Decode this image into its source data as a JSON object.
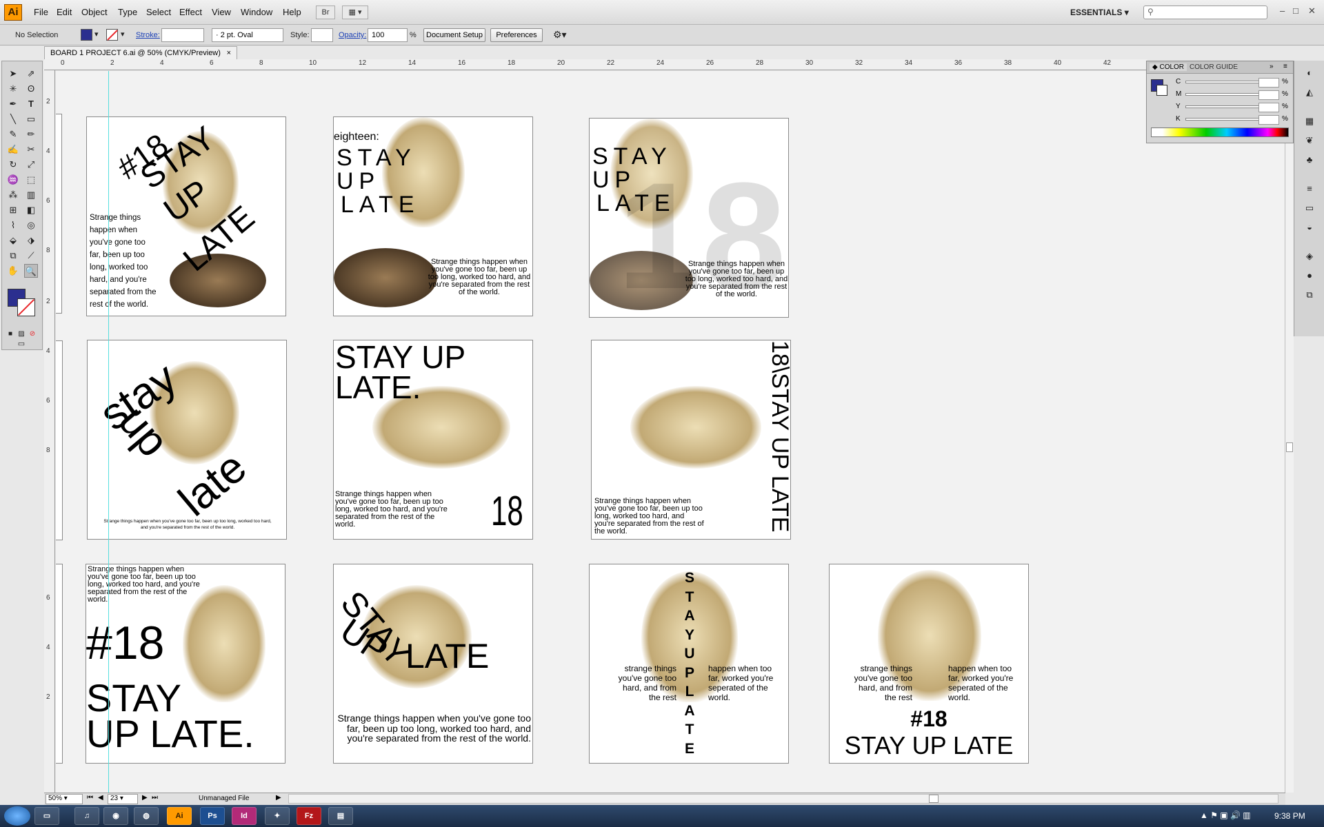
{
  "app": {
    "logo": "Ai"
  },
  "menus": [
    "File",
    "Edit",
    "Object",
    "Type",
    "Select",
    "Effect",
    "View",
    "Window",
    "Help"
  ],
  "bridge_btn": "Br",
  "workspace": "ESSENTIALS",
  "control": {
    "selection": "No Selection",
    "stroke_label": "Stroke:",
    "brush": "2 pt. Oval",
    "style_label": "Style:",
    "opacity_label": "Opacity:",
    "opacity_value": "100",
    "percent": "%",
    "document_setup": "Document Setup",
    "preferences": "Preferences"
  },
  "doc_tab": {
    "title": "BOARD 1 PROJECT 6.ai @ 50% (CMYK/Preview)",
    "close": "×"
  },
  "ruler_h": [
    "0",
    "2",
    "4",
    "6",
    "8",
    "10",
    "12",
    "14",
    "16",
    "18",
    "20",
    "22",
    "24",
    "26",
    "28",
    "30",
    "32",
    "34",
    "36",
    "38",
    "40",
    "42"
  ],
  "ruler_v": [
    "2",
    "4",
    "6",
    "8",
    "2",
    "4",
    "6",
    "8",
    "6",
    "4",
    "2"
  ],
  "artboards": {
    "a1": {
      "l1": "#18",
      "l2": "STAY",
      "l3": "UP",
      "l4": "LATE",
      "body": "Strange things happen when you've gone too far, been up too long, worked too hard, and you're separated from the rest of the world."
    },
    "a2": {
      "eighteen": "eighteen:",
      "s1": "STAY",
      "s2": "UP",
      "s3": "LATE",
      "body": "Strange things happen when you've gone too far, been up too long, worked too hard, and you're separated from the rest of the world."
    },
    "a3": {
      "s1": "STAY",
      "s2": "UP",
      "s3": "LATE",
      "big18": "18",
      "body": "Strange things happen when you've gone too far, been up too long, worked too hard, and you're separated from the rest of the world."
    },
    "a4": {
      "w1": "stay",
      "w2": "up",
      "w3": "late",
      "small": "Strange things happen when you've gone too far, been up too long, worked too hard, and you're separated from the rest of the world."
    },
    "a5": {
      "head": "STAY UP LATE.",
      "body": "Strange things happen when you've gone too far, been up too long, worked too hard, and you're separated from the rest of the world.",
      "num": "18"
    },
    "a6": {
      "vert": "18\\STAY UP LATE",
      "body": "Strange things happen when you've gone too far, been up too long, worked too hard, and you're separated from the rest of the world."
    },
    "a7": {
      "body": "Strange things happen when you've gone too far, been up too long, worked too hard, and you're separated from the rest of the world.",
      "num": "#18",
      "h1": "STAY",
      "h2": "UP LATE."
    },
    "a8": {
      "s1": "STAY",
      "s2": "UP",
      "s3": "LATE",
      "body": "Strange things happen when you've gone too far, been up too long, worked too hard, and you're separated from the rest of the world."
    },
    "a9": {
      "vert": [
        "S",
        "T",
        "A",
        "Y",
        "U",
        "P",
        "L",
        "A",
        "T",
        "E"
      ],
      "left": "strange things you've gone too hard, and from the rest",
      "right": "happen when too far, worked you're seperated of the world."
    },
    "a10": {
      "left": "strange things you've gone too hard, and from the rest",
      "right": "happen when too far, worked you're seperated of the world.",
      "num": "#18",
      "title": "STAY UP LATE"
    }
  },
  "color_panel": {
    "tab1": "COLOR",
    "tab2": "COLOR GUIDE",
    "channels": [
      "C",
      "M",
      "Y",
      "K"
    ],
    "percent": "%"
  },
  "status": {
    "zoom": "50%",
    "page": "23",
    "file_status": "Unmanaged File"
  },
  "taskbar": {
    "clock": "9:38 PM",
    "apps": [
      "Ai",
      "Ps",
      "Id",
      "Fz"
    ]
  },
  "colors": {
    "fill": "#2b2f8f",
    "stroke_none": "#e8262a",
    "accent": "#ff9a00"
  }
}
